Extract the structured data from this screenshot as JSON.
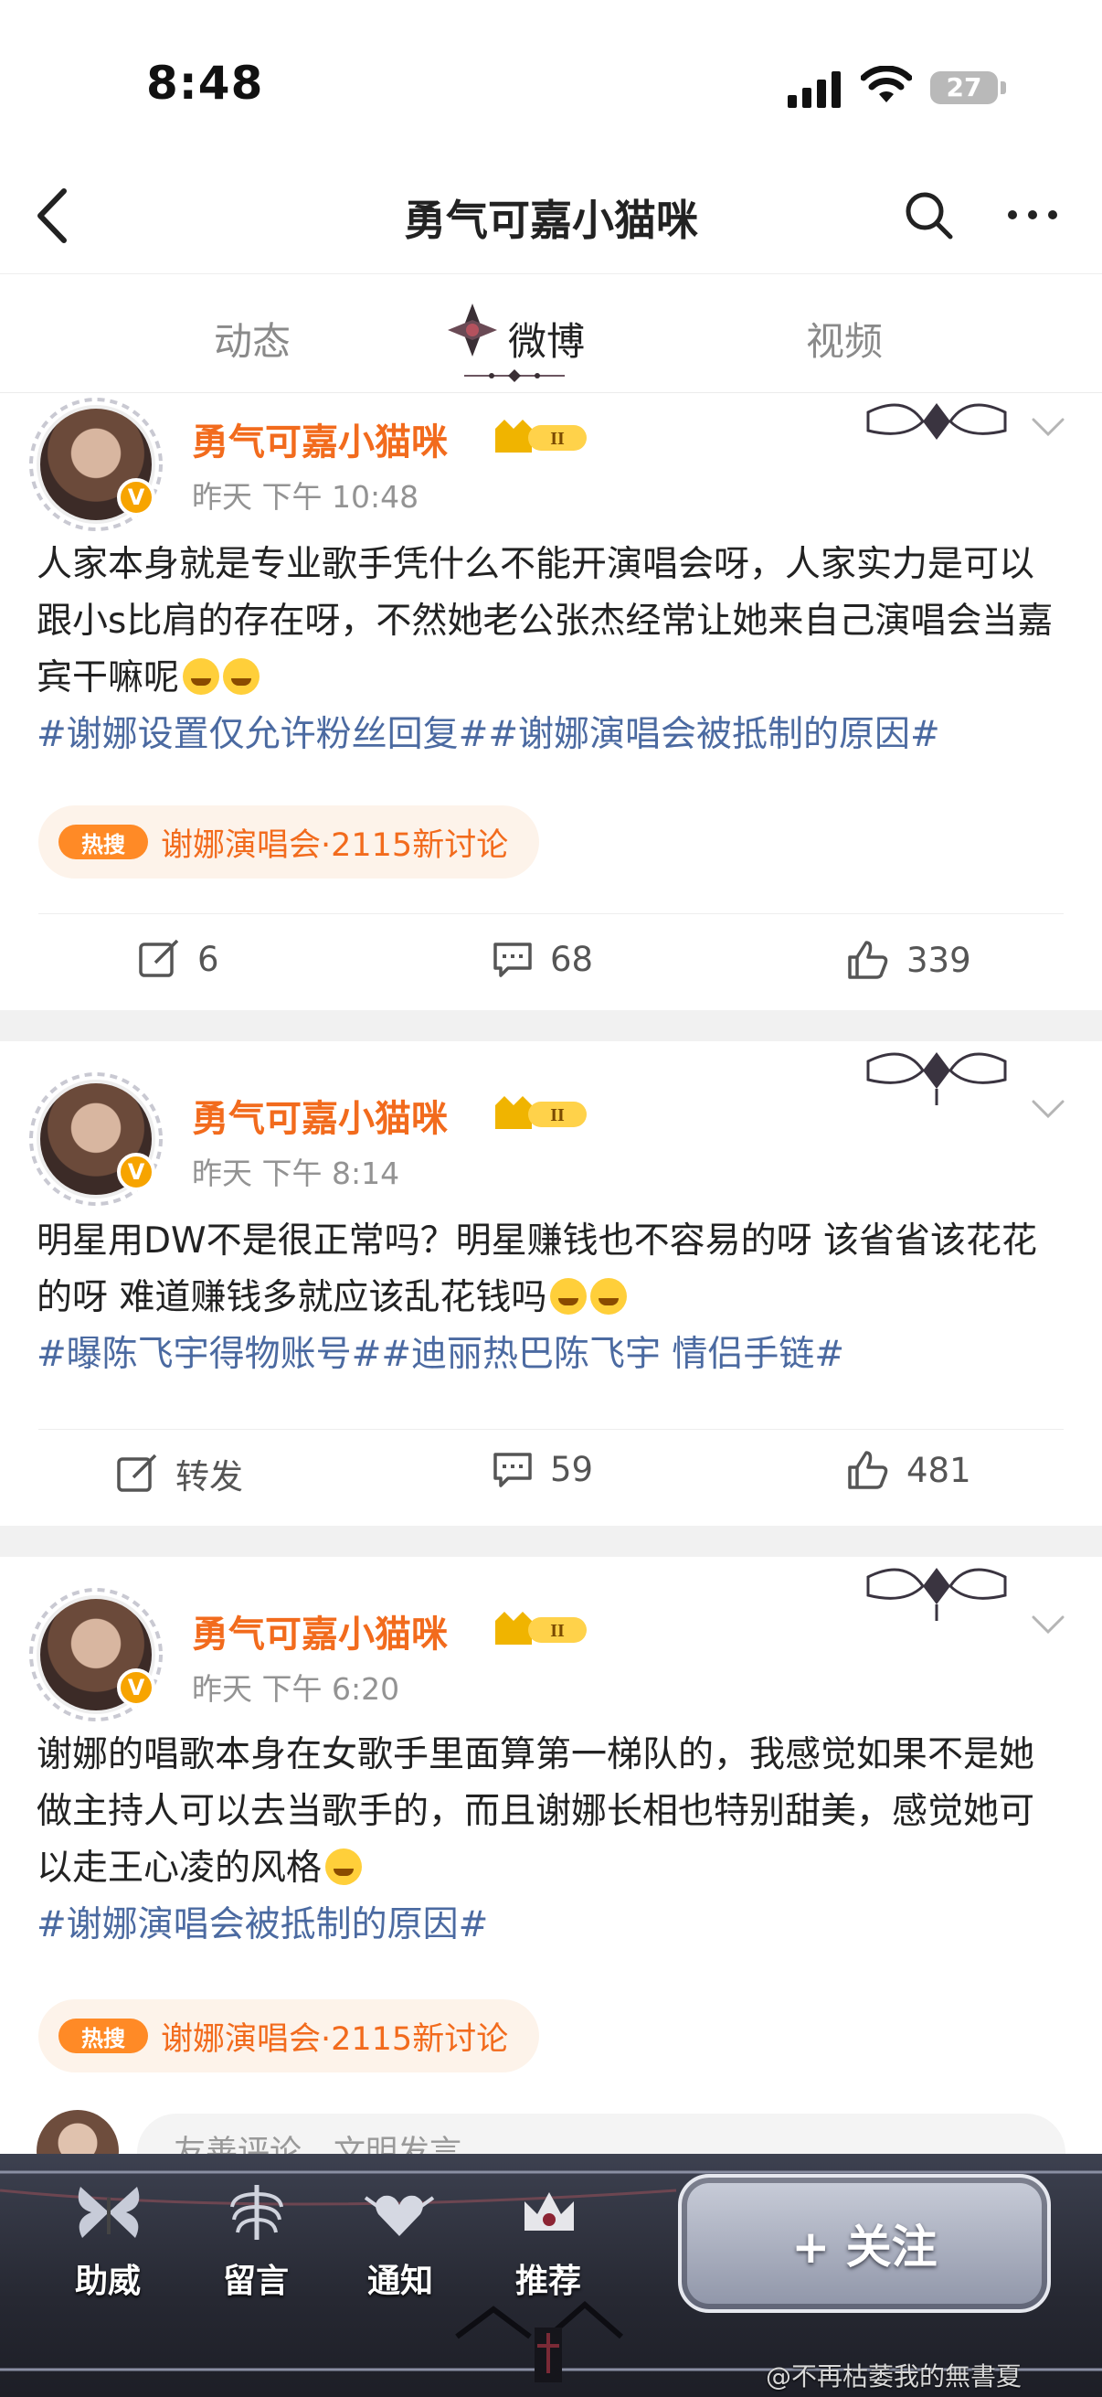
{
  "status_bar": {
    "time": "8:48",
    "battery": "27"
  },
  "nav": {
    "title": "勇气可嘉小猫咪"
  },
  "tabs": {
    "items": [
      "动态",
      "微博",
      "视频"
    ],
    "active": "微博"
  },
  "posts": [
    {
      "username": "勇气可嘉小猫咪",
      "time": "昨天 下午 10:48",
      "text": "人家本身就是专业歌手凭什么不能开演唱会呀，人家实力是可以跟小s比肩的存在呀，不然她老公张杰经常让她来自己演唱会当嘉宾干嘛呢",
      "tags": "#谢娜设置仅允许粉丝回复##谢娜演唱会被抵制的原因#",
      "hot": {
        "badge": "热搜",
        "text": "谢娜演唱会·2115新讨论"
      },
      "repost": "6",
      "comments": "68",
      "likes": "339"
    },
    {
      "username": "勇气可嘉小猫咪",
      "time": "昨天 下午 8:14",
      "text": "明星用DW不是很正常吗？明星赚钱也不容易的呀 该省省该花花的呀 难道赚钱多就应该乱花钱吗",
      "tags": "#曝陈飞宇得物账号##迪丽热巴陈飞宇 情侣手链#",
      "repost": "转发",
      "comments": "59",
      "likes": "481"
    },
    {
      "username": "勇气可嘉小猫咪",
      "time": "昨天 下午 6:20",
      "text": "谢娜的唱歌本身在女歌手里面算第一梯队的，我感觉如果不是她做主持人可以去当歌手的，而且谢娜长相也特别甜美，感觉她可以走王心凌的风格",
      "tags": "#谢娜演唱会被抵制的原因#",
      "hot": {
        "badge": "热搜",
        "text": "谢娜演唱会·2115新讨论"
      }
    }
  ],
  "comment_bar": {
    "placeholder": "友善评论，文明发言"
  },
  "bottom_bar": {
    "items": [
      "助威",
      "留言",
      "通知",
      "推荐"
    ],
    "follow_label": "+ 关注",
    "watermark": "@不再枯萎我的無書夏"
  },
  "colors": {
    "accent_orange": "#f26b1d",
    "topic_blue": "#4b6aa1",
    "hot_pill_bg": "#fdf3ea"
  }
}
